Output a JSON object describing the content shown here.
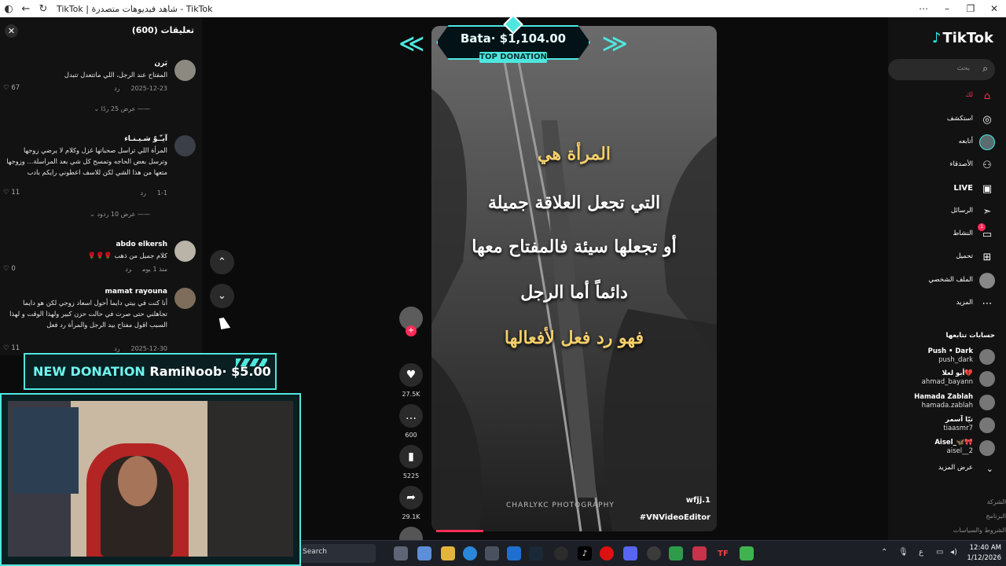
{
  "window": {
    "title": "TikTok | شاهد فيديوهات متصدرة - TikTok",
    "controls": {
      "more": "⋯",
      "minimize": "–",
      "restore": "❐",
      "close": "✕"
    }
  },
  "comments": {
    "header": "تعليقات (600)",
    "items": [
      {
        "name": "بَرن",
        "text": "المفتاح عند الرجل، اللي ماتتعدل تتبدل",
        "date": "2025-12-23",
        "reply": "رد",
        "likes": "67",
        "more": "عرض 25 ردًا"
      },
      {
        "name": "آيـّـوّ شـيـنـاء",
        "text": "المرأة اللي تراسل صحباتها غزل وكلام لا يرضي زوجها وترسل بعض الحاجه وتمسح كل شي بعد المراسلة... وزوجها متعها من هذا الشي لكن للاسف اعطوني رايكم بادب",
        "date": "1-1",
        "reply": "رد",
        "likes": "11",
        "more": "عرض 10 ردود"
      },
      {
        "name": "abdo elkersh",
        "text": "كلام جميل من ذهب 🌹🌹🌹",
        "date": "منذ 1 يوم",
        "reply": "رد",
        "likes": "0"
      },
      {
        "name": "mamat rayouna",
        "text": "أنا كنت في بيتي دايما أحول اسعاد زوجي لكن هو دايما تجاهلني حتى صرت في حالت حزن كبير ولهذا الوقت و لهذا السبب اقول مفتاح بيد الرجل والمرأة رد فعل",
        "date": "2025-12-30",
        "reply": "رد",
        "likes": "11"
      }
    ]
  },
  "video": {
    "lines": [
      "المرأة هي",
      "التي تجعل العلاقة جميلة",
      "أو تجعلها سيئة فالمفتاح معها",
      "دائماً أما الرجل",
      "فهو رد فعل لأفعالها"
    ],
    "watermark": "CHARLYKC PHOTOGRAPHY",
    "tag1": "wfjj.1",
    "tag2": "#VNVideoEditor"
  },
  "actions": {
    "likes": "27.5K",
    "comments": "600",
    "saves": "5225",
    "shares": "29.1K"
  },
  "overlay": {
    "top_donation_amount": "Bata· $1,104.00",
    "top_donation_label": "TOP DONATION",
    "new_donation_label": "NEW DONATION",
    "new_donation_text": "RamiNoob· $5.00"
  },
  "sidebar": {
    "logo": "TikTok",
    "search_placeholder": "بحث",
    "items": [
      {
        "label": "لك"
      },
      {
        "label": "استكشف"
      },
      {
        "label": "أتابعه"
      },
      {
        "label": "الأصدقاء"
      },
      {
        "label": "LIVE"
      },
      {
        "label": "الرسائل"
      },
      {
        "label": "النشاط",
        "badge": "1"
      },
      {
        "label": "تحميل"
      },
      {
        "label": "الملف الشخصي"
      },
      {
        "label": "المزيد"
      }
    ],
    "following_header": "حسابات تتابعها",
    "accounts": [
      {
        "name": "Push • Dark",
        "user": "push_dark"
      },
      {
        "name": "أبو لعلا💔",
        "user": "ahmad_bayann"
      },
      {
        "name": "Hamada Zablah",
        "user": "hamada.zablah"
      },
      {
        "name": "تيّا آسمر",
        "user": "tiaasmr7"
      },
      {
        "name": "Aisel_🦋🎀",
        "user": "aisel__2"
      }
    ],
    "see_more": "عرض المزيد",
    "footer": [
      "الشركة",
      "البرنامج",
      "الشروط والسياسات"
    ]
  },
  "taskbar": {
    "search": "Search",
    "time": "12:40 AM",
    "date": "1/12/2026",
    "lang": "ع"
  }
}
